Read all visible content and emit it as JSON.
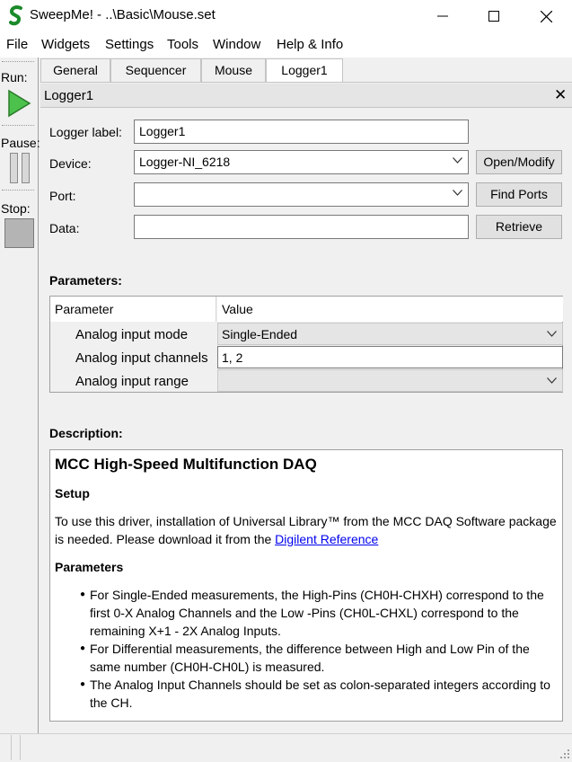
{
  "window": {
    "title": "SweepMe! - ..\\Basic\\Mouse.set",
    "brand_color": "#1a8a2a"
  },
  "menu": [
    "File",
    "Widgets",
    "Settings",
    "Tools",
    "Window",
    "Help & Info"
  ],
  "left_panel": {
    "run_label": "Run:",
    "pause_label": "Pause:",
    "stop_label": "Stop:"
  },
  "tabs": [
    {
      "label": "General",
      "active": false
    },
    {
      "label": "Sequencer",
      "active": false
    },
    {
      "label": "Mouse",
      "active": false
    },
    {
      "label": "Logger1",
      "active": true
    }
  ],
  "dock": {
    "title": "Logger1",
    "close_glyph": "✕"
  },
  "form": {
    "logger_label_label": "Logger label:",
    "logger_label_value": "Logger1",
    "device_label": "Device:",
    "device_value": "Logger-NI_6218",
    "port_label": "Port:",
    "port_value": "",
    "data_label": "Data:",
    "data_value": "",
    "open_modify_button": "Open/Modify",
    "find_ports_button": "Find Ports",
    "retrieve_button": "Retrieve"
  },
  "parameters": {
    "section_title": "Parameters:",
    "header_parameter": "Parameter",
    "header_value": "Value",
    "rows": [
      {
        "name": "Analog input mode",
        "value": "Single-Ended",
        "type": "combo"
      },
      {
        "name": "Analog input channels",
        "value": "1, 2",
        "type": "text"
      },
      {
        "name": "Analog input range",
        "value": "",
        "type": "combo"
      }
    ]
  },
  "description": {
    "section_title": "Description:",
    "heading": "MCC High-Speed Multifunction DAQ",
    "setup_heading": "Setup",
    "setup_text": "To use this driver, installation of Universal Library™ from the MCC DAQ Software package is needed. Please download it from the ",
    "setup_link": "Digilent Reference",
    "parameters_heading": "Parameters",
    "bullets": [
      "For Single-Ended measurements, the High-Pins (CH0H-CHXH) correspond to the first 0-X Analog Channels and the Low -Pins (CH0L-CHXL) correspond to the remaining X+1 - 2X Analog Inputs.",
      "For Differential measurements, the difference between High and Low Pin of the same number (CH0H-CH0L) is measured.",
      "The Analog Input Channels should be set as colon-separated integers according to the CH."
    ]
  }
}
